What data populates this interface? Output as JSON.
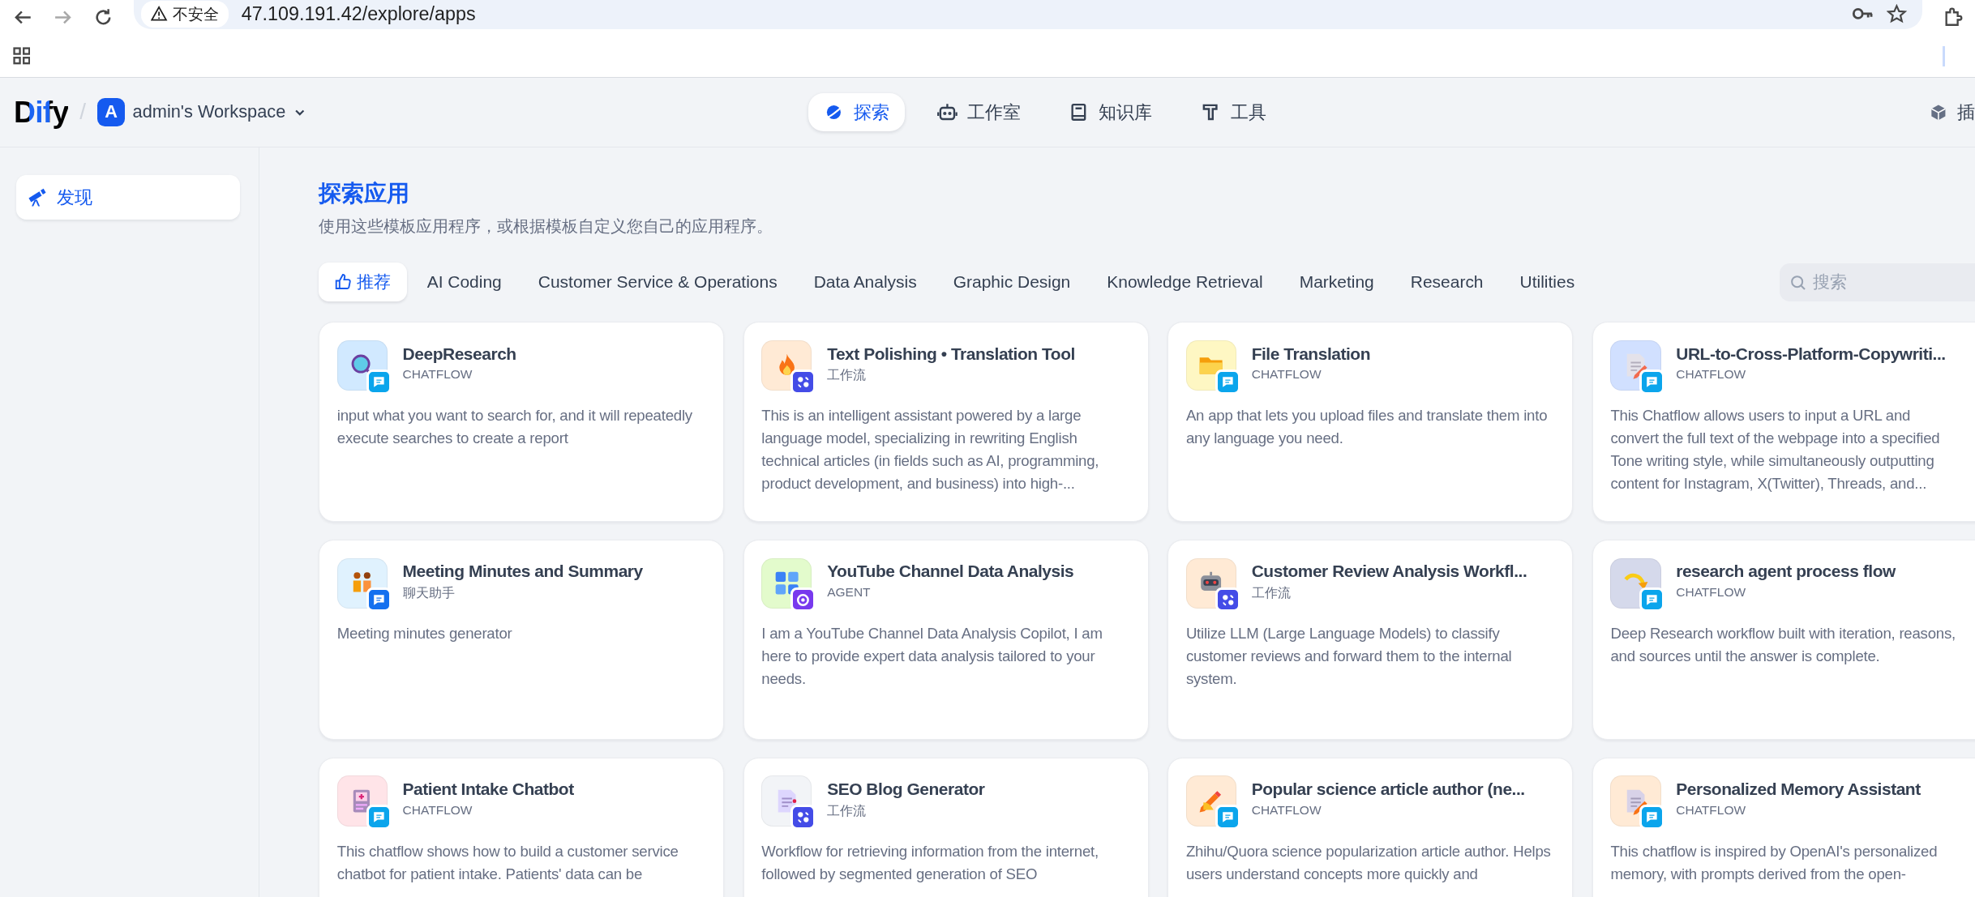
{
  "browser": {
    "security_label": "不安全",
    "url": "47.109.191.42/explore/apps"
  },
  "header": {
    "logo": "Dify",
    "separator": "/",
    "workspace": {
      "initial": "A",
      "name": "admin's Workspace"
    },
    "nav": [
      {
        "label": "探索",
        "selected": true
      },
      {
        "label": "工作室",
        "selected": false
      },
      {
        "label": "知识库",
        "selected": false
      },
      {
        "label": "工具",
        "selected": false
      }
    ],
    "plugins_label": "插"
  },
  "sidebar": {
    "items": [
      {
        "label": "发现",
        "selected": true
      }
    ]
  },
  "explore": {
    "title": "探索应用",
    "subtitle": "使用这些模板应用程序，或根据模板自定义您自己的应用程序。",
    "categories": [
      {
        "label": "推荐",
        "kind": "recommended",
        "selected": true
      },
      {
        "label": "AI Coding",
        "kind": "category",
        "selected": false
      },
      {
        "label": "Customer Service & Operations",
        "kind": "category",
        "selected": false
      },
      {
        "label": "Data Analysis",
        "kind": "category",
        "selected": false
      },
      {
        "label": "Graphic Design",
        "kind": "category",
        "selected": false
      },
      {
        "label": "Knowledge Retrieval",
        "kind": "category",
        "selected": false
      },
      {
        "label": "Marketing",
        "kind": "category",
        "selected": false
      },
      {
        "label": "Research",
        "kind": "category",
        "selected": false
      },
      {
        "label": "Utilities",
        "kind": "category",
        "selected": false
      }
    ],
    "search": {
      "placeholder": "搜索"
    },
    "apps": [
      {
        "name": "DeepResearch",
        "mode": "CHATFLOW",
        "kind": "chatflow",
        "color": "#d1e9ff",
        "description": "input what you want to search for, and it will repeatedly execute searches to create a report"
      },
      {
        "name": "Text Polishing • Translation Tool",
        "mode": "工作流",
        "kind": "workflow",
        "color": "#ffead5",
        "description": "This is an intelligent assistant powered by a large language model, specializing in rewriting English technical articles (in fields such as AI, programming, product development, and business) into high-..."
      },
      {
        "name": "File Translation",
        "mode": "CHATFLOW",
        "kind": "chatflow",
        "color": "#fef7c3",
        "description": "An app that lets you upload files and translate them into any language you need."
      },
      {
        "name": "URL-to-Cross-Platform-Copywriti...",
        "mode": "CHATFLOW",
        "kind": "chatflow",
        "color": "#d1e0ff",
        "description": "This Chatflow allows users to input a URL and convert the full text of the webpage into a specified Tone writing style, while simultaneously outputting content for Instagram, X(Twitter), Threads, and..."
      },
      {
        "name": "Meeting Minutes and Summary",
        "mode": "聊天助手",
        "kind": "chat",
        "color": "#e0f2fe",
        "description": "Meeting minutes generator"
      },
      {
        "name": "YouTube Channel Data Analysis",
        "mode": "AGENT",
        "kind": "agent",
        "color": "#e3fbcc",
        "description": "I am a YouTube Channel Data Analysis Copilot, I am here to provide expert data analysis tailored to your needs."
      },
      {
        "name": "Customer Review Analysis Workfl...",
        "mode": "工作流",
        "kind": "workflow",
        "color": "#ffead5",
        "description": "Utilize LLM (Large Language Models) to classify customer reviews and forward them to the internal system."
      },
      {
        "name": "research agent process flow",
        "mode": "CHATFLOW",
        "kind": "chatflow",
        "color": "#d5d9eb",
        "description": "Deep Research workflow built with iteration, reasons, and sources until the answer is complete."
      },
      {
        "name": "Patient Intake Chatbot",
        "mode": "CHATFLOW",
        "kind": "chatflow",
        "color": "#ffe4e8",
        "description": "This chatflow shows how to build a customer service chatbot for patient intake. Patients' data can be"
      },
      {
        "name": "SEO Blog Generator",
        "mode": "工作流",
        "kind": "workflow",
        "color": "#f2f4f7",
        "description": "Workflow for retrieving information from the internet, followed by segmented generation of SEO"
      },
      {
        "name": "Popular science article author (ne...",
        "mode": "CHATFLOW",
        "kind": "chatflow",
        "color": "#ffead5",
        "description": "Zhihu/Quora science popularization article author. Helps users understand concepts more quickly and"
      },
      {
        "name": "Personalized Memory Assistant",
        "mode": "CHATFLOW",
        "kind": "chatflow",
        "color": "#ffead5",
        "description": "This chatflow is inspired by OpenAI's personalized memory, with prompts derived from the open-"
      }
    ]
  }
}
